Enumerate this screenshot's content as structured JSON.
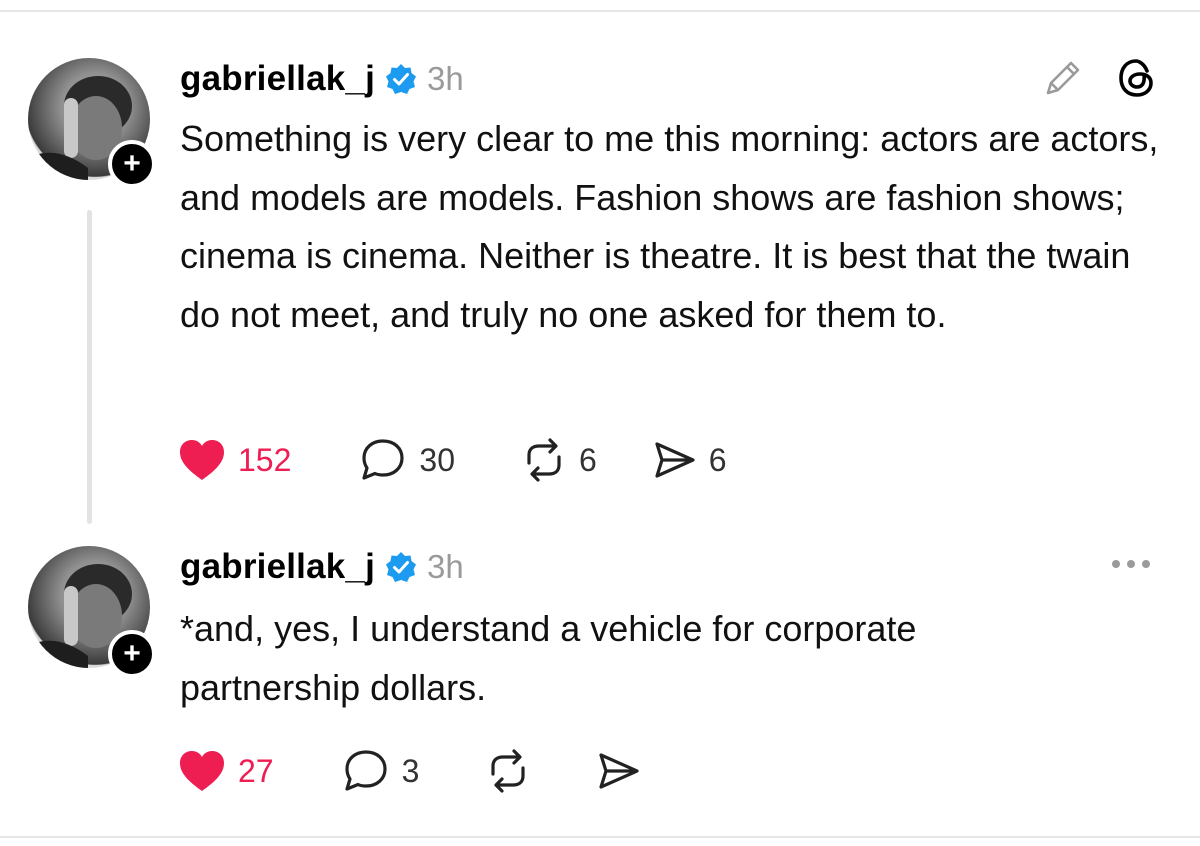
{
  "colors": {
    "like": "#ee1d52",
    "verified": "#1d9bf0",
    "muted": "#9a9a9a"
  },
  "icons": {
    "edit": "pencil-icon",
    "app": "threads-logo-icon",
    "more": "more-dots-icon"
  },
  "posts": [
    {
      "username": "gabriellak_j",
      "time": "3h",
      "text": "Something is very clear to me this morning: actors are actors, and models are models. Fashion shows are fashion shows; cinema is cinema. Neither is theatre. It is best that the twain do not meet, and truly no one asked for them to.",
      "likes": "152",
      "replies": "30",
      "reposts": "6",
      "shares": "6"
    },
    {
      "username": "gabriellak_j",
      "time": "3h",
      "text": "*and, yes, I understand a vehicle for corporate partnership dollars.",
      "likes": "27",
      "replies": "3",
      "reposts": "",
      "shares": ""
    }
  ]
}
